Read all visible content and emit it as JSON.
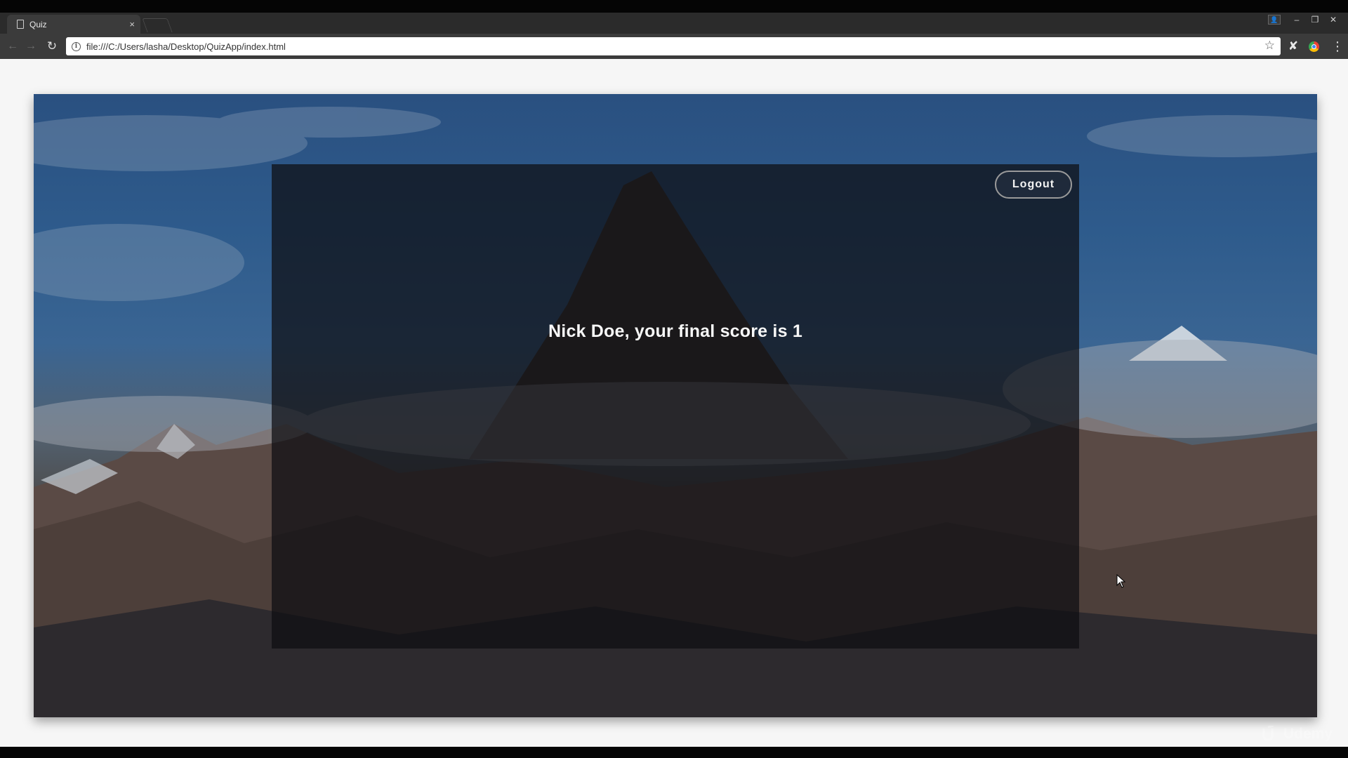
{
  "browser": {
    "tab": {
      "title": "Quiz",
      "close": "×"
    },
    "address_bar": {
      "url": "file:///C:/Users/lasha/Desktop/QuizApp/index.html"
    },
    "icons": {
      "back": "←",
      "forward": "→",
      "reload": "↻",
      "info": "i",
      "star": "☆",
      "extension": "✘",
      "menu": "⋮",
      "profile": "👤",
      "minimize": "–",
      "restore": "❐",
      "close": "✕"
    }
  },
  "page": {
    "logout_label": "Logout",
    "score_message": "Nick Doe, your final score is 1"
  },
  "watermark": {
    "text": "Udemy"
  },
  "colors": {
    "card_overlay": "rgba(14,14,18,0.72)",
    "page_bg": "#f6f6f6",
    "chrome_dark": "#3b3b3b"
  }
}
